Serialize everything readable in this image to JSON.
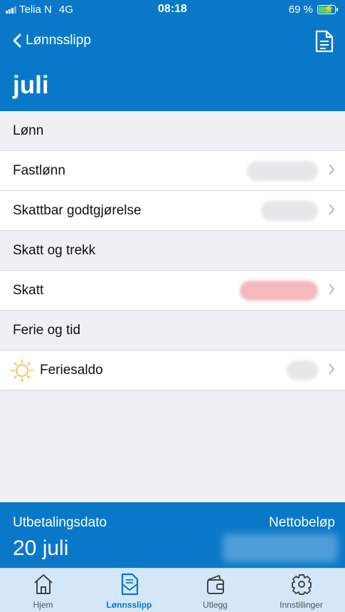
{
  "status": {
    "carrier": "Telia N",
    "network": "4G",
    "time": "08:18",
    "battery": "69 %"
  },
  "nav": {
    "back_label": "Lønnsslipp",
    "title": "juli"
  },
  "list": {
    "sections": [
      {
        "title": "Lønn",
        "items": [
          {
            "label": "Fastlønn"
          },
          {
            "label": "Skattbar godtgjørelse"
          }
        ]
      },
      {
        "title": "Skatt og trekk",
        "items": [
          {
            "label": "Skatt"
          }
        ]
      },
      {
        "title": "Ferie og tid",
        "items": [
          {
            "label": "Feriesaldo",
            "icon": "sun-icon"
          }
        ]
      }
    ]
  },
  "footer": {
    "date_label": "Utbetalingsdato",
    "date_value": "20 juli",
    "amount_label": "Nettobeløp"
  },
  "tabs": [
    {
      "label": "Hjem",
      "icon": "home-icon",
      "active": false
    },
    {
      "label": "Lønnsslipp",
      "icon": "payslip-icon",
      "active": true
    },
    {
      "label": "Utlegg",
      "icon": "wallet-icon",
      "active": false
    },
    {
      "label": "Innstillinger",
      "icon": "gear-icon",
      "active": false
    }
  ],
  "colors": {
    "brand": "#0a78c8",
    "tab_bar": "#d3e7f8",
    "tax_blur": "#f3b9bf",
    "sun": "#f2b63a"
  }
}
